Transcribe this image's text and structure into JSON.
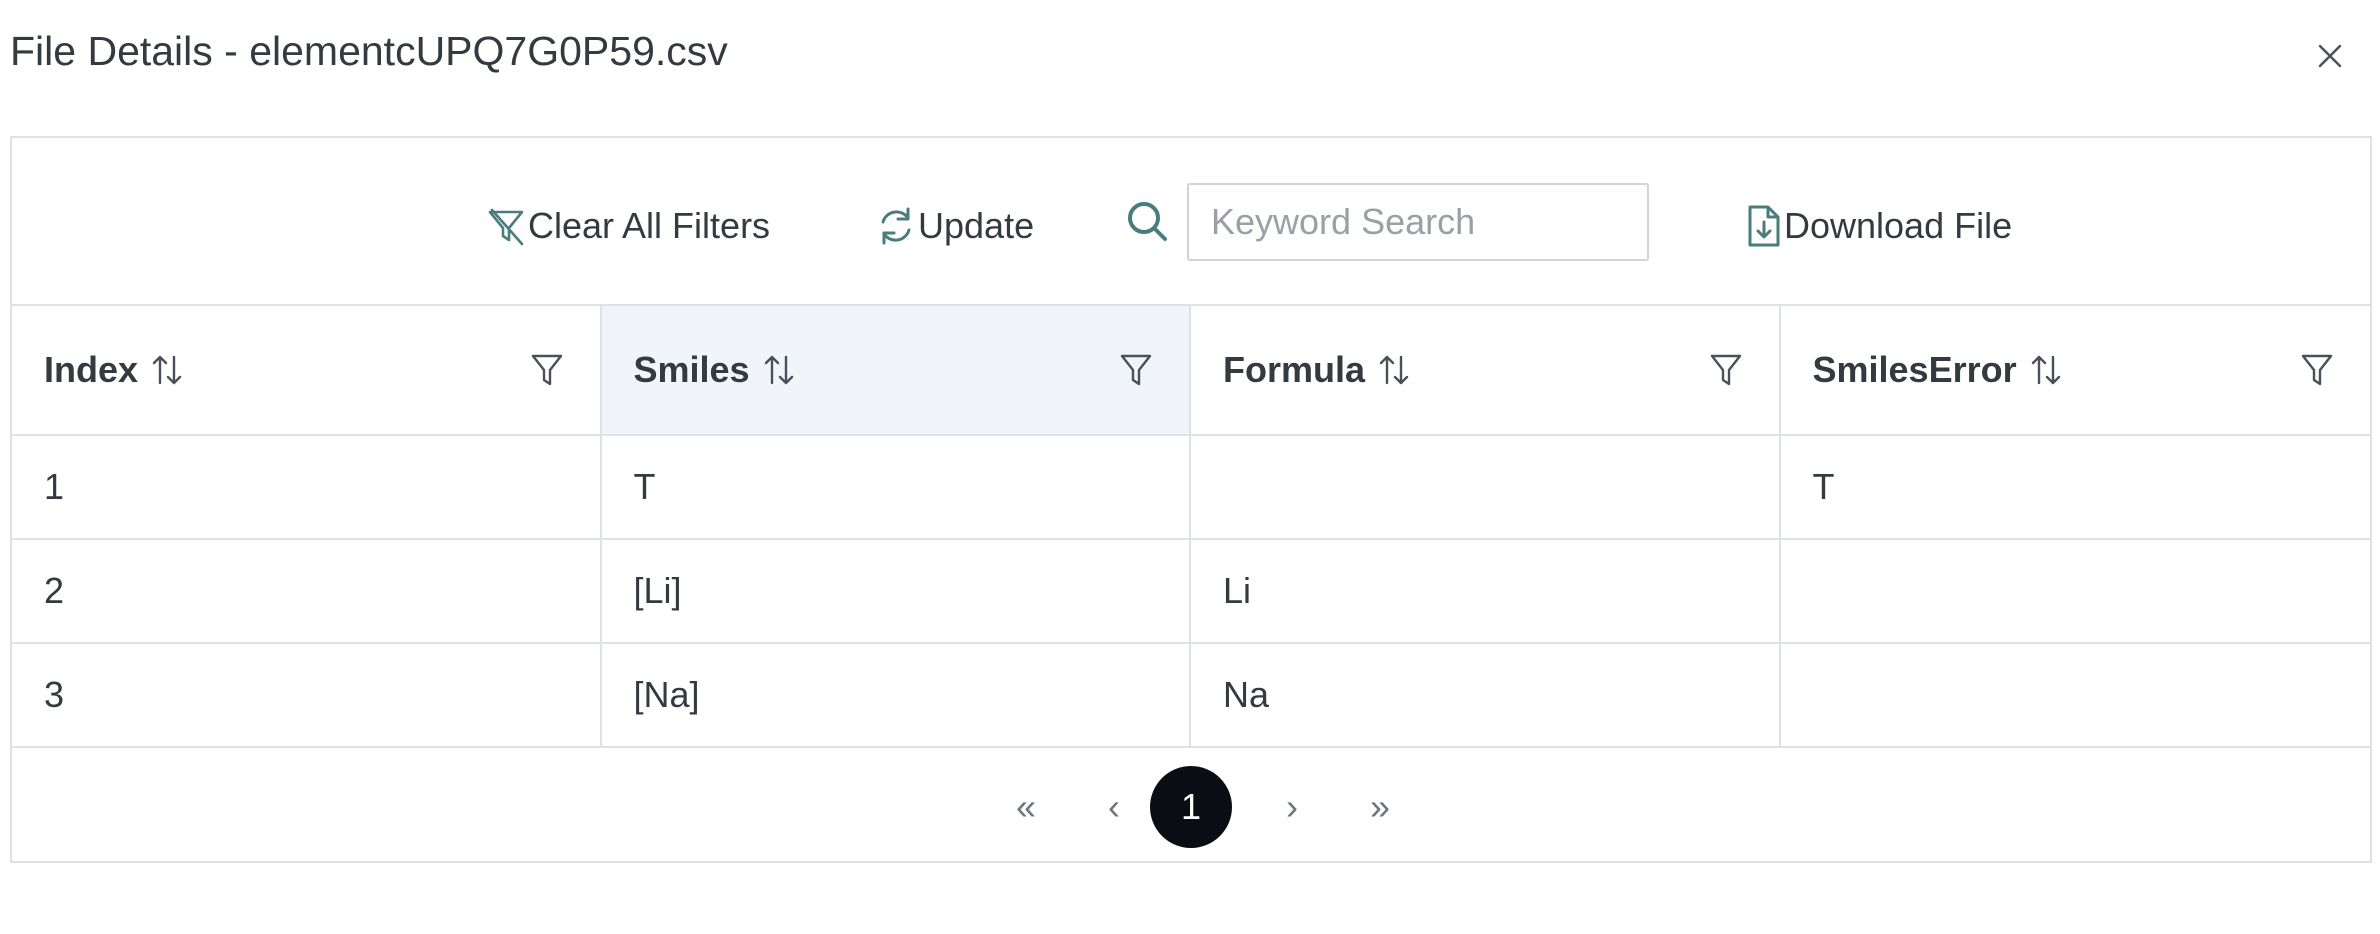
{
  "dialog": {
    "title": "File Details - elementcUPQ7G0P59.csv"
  },
  "toolbar": {
    "clear_filters_label": "Clear All Filters",
    "update_label": "Update",
    "search_placeholder": "Keyword Search",
    "search_value": "",
    "download_label": "Download File"
  },
  "table": {
    "columns": [
      "Index",
      "Smiles",
      "Formula",
      "SmilesError"
    ],
    "sorted_column": "Smiles",
    "rows": [
      [
        "1",
        "T",
        "",
        "T"
      ],
      [
        "2",
        "[Li]",
        "Li",
        ""
      ],
      [
        "3",
        "[Na]",
        "Na",
        ""
      ]
    ]
  },
  "pagination": {
    "first": "«",
    "prev": "‹",
    "current_page": "1",
    "next": "›",
    "last": "»"
  },
  "colors": {
    "accent": "#4a7c7e",
    "border": "#dee2e6",
    "sorted_header_bg": "#f1f4f9",
    "active_page_bg": "#0b0d14"
  }
}
